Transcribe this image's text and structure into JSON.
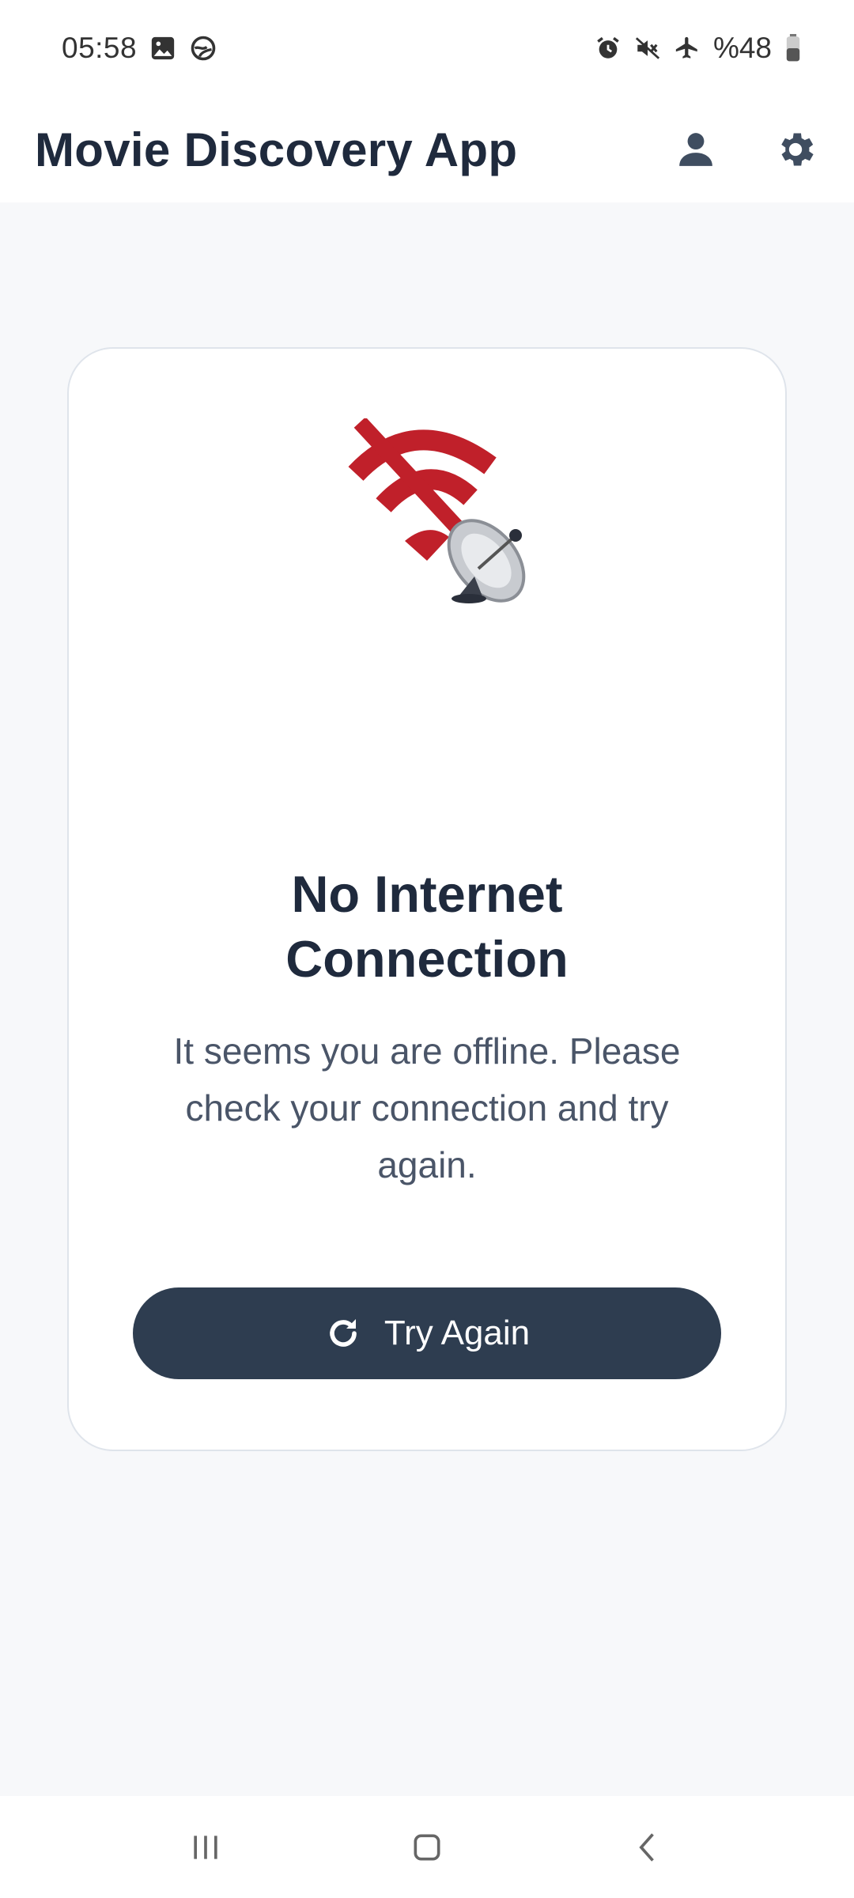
{
  "status_bar": {
    "time": "05:58",
    "battery_text": "%48",
    "icons": [
      "gallery-icon",
      "sync-icon",
      "alarm-icon",
      "mute-icon",
      "airplane-icon",
      "battery-icon"
    ]
  },
  "app_bar": {
    "title": "Movie Discovery App",
    "actions": [
      "profile-icon",
      "settings-icon"
    ]
  },
  "error_card": {
    "illustration": "no-wifi-satellite-icon",
    "title_line1": "No Internet",
    "title_line2": "Connection",
    "message": "It seems you are offline. Please check your connection and try again.",
    "button_label": "Try Again",
    "button_icon": "refresh-icon"
  },
  "nav_bar": {
    "items": [
      "recent-apps-icon",
      "home-icon",
      "back-icon"
    ]
  },
  "colors": {
    "primary_dark": "#2e3d50",
    "title_text": "#1f2a3d",
    "body_text": "#4a5568",
    "background": "#f7f8fa",
    "error_red": "#c0202a"
  }
}
